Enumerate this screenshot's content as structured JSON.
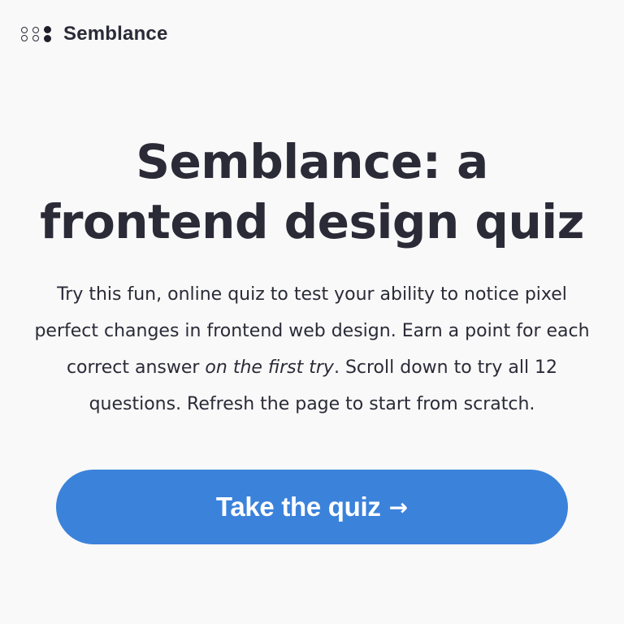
{
  "header": {
    "logo_icon": "dot-grid-logo-icon",
    "brand_name": "Semblance"
  },
  "hero": {
    "title_line_1": "Semblance: a",
    "title_line_2": "frontend design quiz",
    "description_part_1": "Try this fun, online quiz to test your ability to notice pixel perfect changes in frontend web design. Earn a point for each correct answer ",
    "description_emphasis": "on the first try",
    "description_part_2": ". Scroll down to try all 12 questions. Refresh the page to start from scratch."
  },
  "cta": {
    "label": "Take the quiz",
    "icon": "arrow-right-icon",
    "arrow_glyph": "→"
  },
  "colors": {
    "background": "#f9f9f9",
    "text": "#2b2b38",
    "accent": "#3b82db",
    "button_text": "#ffffff"
  }
}
